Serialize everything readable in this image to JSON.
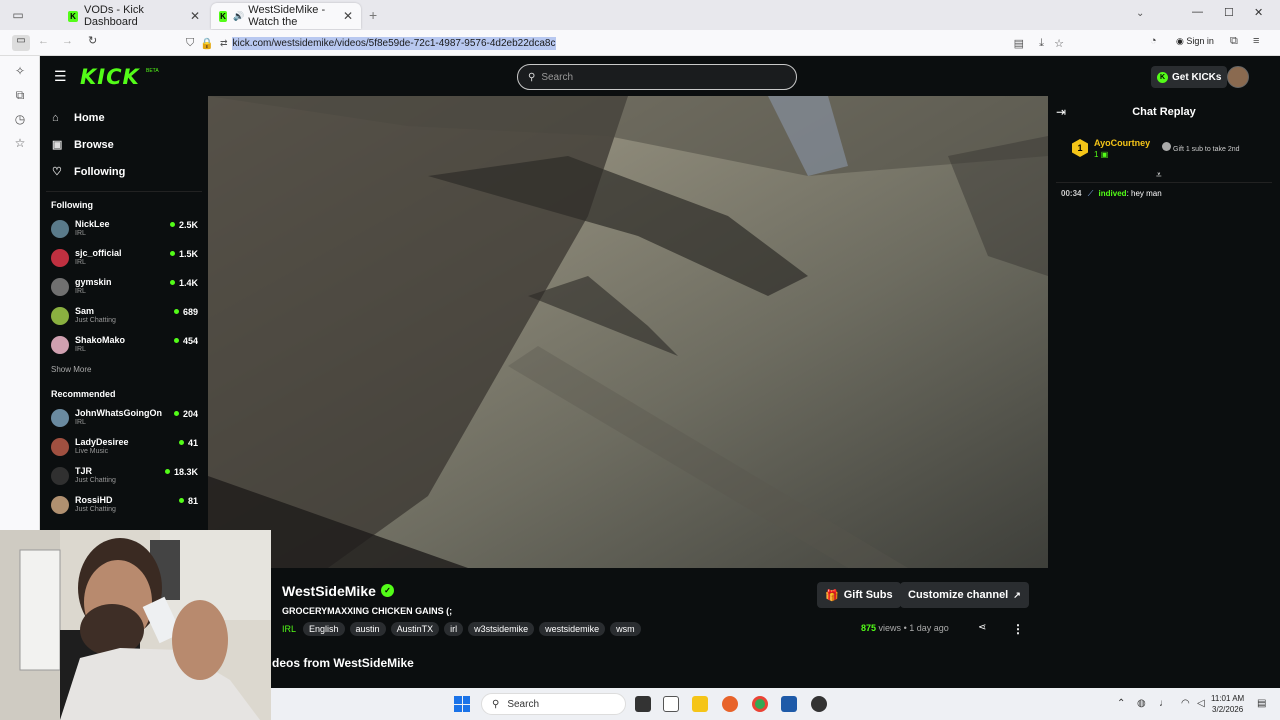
{
  "browser": {
    "tabs": [
      {
        "title": "VODs - Kick Dashboard",
        "active": false
      },
      {
        "title": "WestSideMike - Watch the",
        "active": true
      }
    ],
    "url": "kick.com/westsidemike/videos/5f8e59de-72c1-4987-9576-4d2eb22dca8c",
    "sign_in": "Sign in"
  },
  "header": {
    "logo": "KICK",
    "logo_badge": "BETA",
    "search_placeholder": "Search",
    "get_kicks": "Get KICKs"
  },
  "nav": {
    "home": "Home",
    "browse": "Browse",
    "following": "Following"
  },
  "following": {
    "heading": "Following",
    "channels": [
      {
        "name": "NickLee",
        "category": "IRL",
        "viewers": "2.5K",
        "color": "#5a7a8a"
      },
      {
        "name": "sjc_official",
        "category": "IRL",
        "viewers": "1.5K",
        "color": "#c03040"
      },
      {
        "name": "gymskin",
        "category": "IRL",
        "viewers": "1.4K",
        "color": "#707070"
      },
      {
        "name": "Sam",
        "category": "Just Chatting",
        "viewers": "689",
        "color": "#8ab040"
      },
      {
        "name": "ShakoMako",
        "category": "IRL",
        "viewers": "454",
        "color": "#d0a0b0"
      }
    ],
    "show_more": "Show More"
  },
  "recommended": {
    "heading": "Recommended",
    "channels": [
      {
        "name": "JohnWhatsGoingOn",
        "category": "IRL",
        "viewers": "204",
        "color": "#6a8aa0"
      },
      {
        "name": "LadyDesiree",
        "category": "Live Music",
        "viewers": "41",
        "color": "#a05040"
      },
      {
        "name": "TJR",
        "category": "Just Chatting",
        "viewers": "18.3K",
        "color": "#303030"
      },
      {
        "name": "RossiHD",
        "category": "Just Chatting",
        "viewers": "81",
        "color": "#b09070"
      }
    ]
  },
  "video": {
    "channel_name": "WestSideMike",
    "title": "GROCERYMAXXING CHICKEN GAINS (;",
    "category": "IRL",
    "tags": [
      "English",
      "austin",
      "AustinTX",
      "irl",
      "w3stsidemike",
      "westsidemike",
      "wsm"
    ],
    "gift_subs": "Gift Subs",
    "customize": "Customize channel",
    "views": "875",
    "views_label": "views",
    "age": "1 day ago",
    "more_videos": "deos from WestSideMike"
  },
  "chat": {
    "title": "Chat Replay",
    "pinned": {
      "rank": "1",
      "user": "AyoCourtney",
      "count": "1",
      "gift_text": "Gift 1 sub to take 2nd"
    },
    "messages": [
      {
        "time": "00:34",
        "user": "indived",
        "text": "hey man"
      }
    ]
  },
  "taskbar": {
    "search": "Search",
    "time": "11:01 AM",
    "date": "3/2/2026"
  },
  "colors": {
    "accent": "#53fc18",
    "background": "#0b0e0f",
    "button": "#2a2d30"
  }
}
